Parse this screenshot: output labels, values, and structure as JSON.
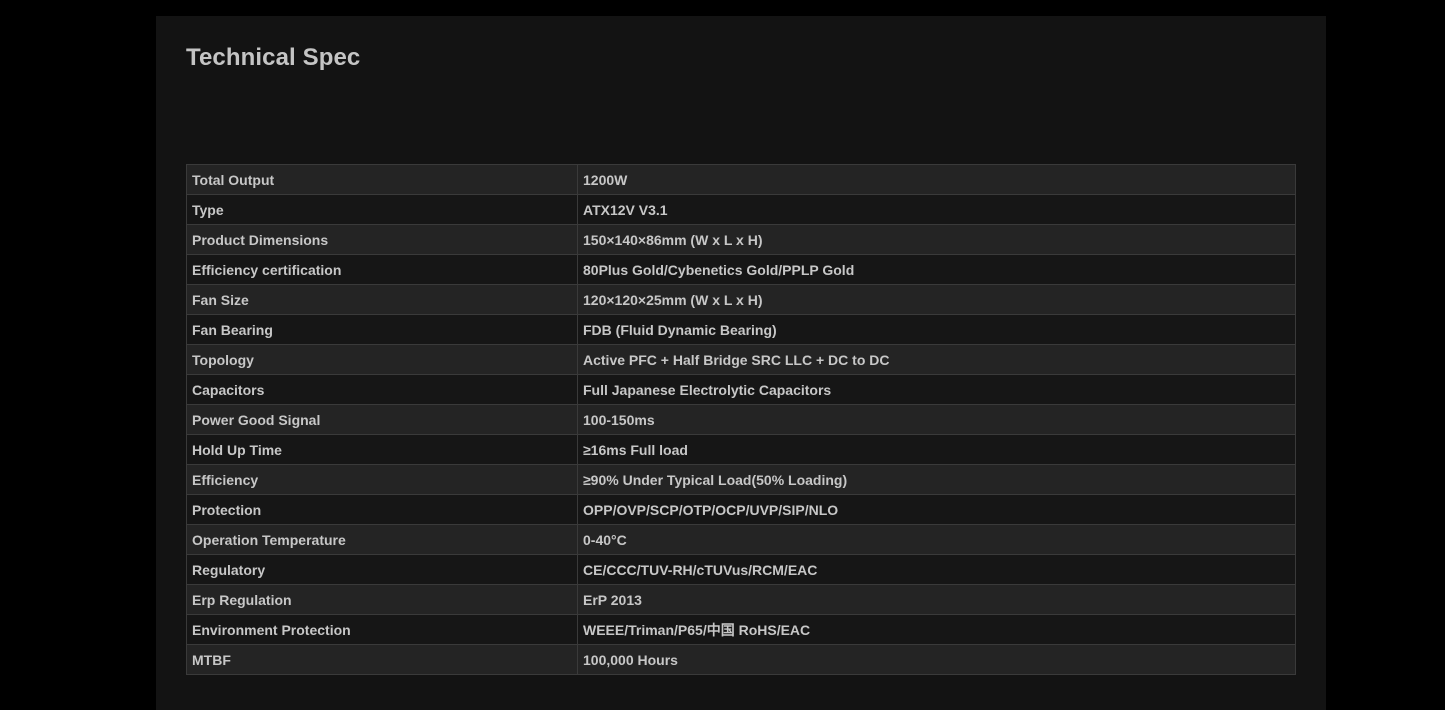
{
  "page": {
    "title": "Technical Spec"
  },
  "colors": {
    "background": "#000000",
    "panel": "#131313",
    "row_odd": "#242424",
    "row_even": "#161616",
    "border": "#3a3a3a",
    "text": "#c7c7c7"
  },
  "spec_table": {
    "rows": [
      {
        "label": "Total Output",
        "value": "1200W"
      },
      {
        "label": "Type",
        "value": "ATX12V V3.1"
      },
      {
        "label": "Product Dimensions",
        "value": "150×140×86mm (W x L x H)"
      },
      {
        "label": "Efficiency certification",
        "value": "80Plus Gold/Cybenetics Gold/PPLP Gold"
      },
      {
        "label": "Fan Size",
        "value": "120×120×25mm (W x L x H)"
      },
      {
        "label": "Fan Bearing",
        "value": "FDB (Fluid Dynamic Bearing)"
      },
      {
        "label": "Topology",
        "value": "Active PFC + Half Bridge SRC LLC + DC to DC"
      },
      {
        "label": "Capacitors",
        "value": "Full Japanese Electrolytic Capacitors"
      },
      {
        "label": "Power Good Signal",
        "value": "100-150ms"
      },
      {
        "label": "Hold Up Time",
        "value": "≥16ms Full load"
      },
      {
        "label": "Efficiency",
        "value": "≥90% Under Typical Load(50% Loading)"
      },
      {
        "label": "Protection",
        "value": "OPP/OVP/SCP/OTP/OCP/UVP/SIP/NLO"
      },
      {
        "label": "Operation Temperature",
        "value": "0-40°C"
      },
      {
        "label": "Regulatory",
        "value": "CE/CCC/TUV-RH/cTUVus/RCM/EAC"
      },
      {
        "label": "Erp Regulation",
        "value": "ErP 2013"
      },
      {
        "label": "Environment Protection",
        "value": "WEEE/Triman/P65/中国 RoHS/EAC"
      },
      {
        "label": "MTBF",
        "value": "100,000 Hours"
      }
    ]
  }
}
